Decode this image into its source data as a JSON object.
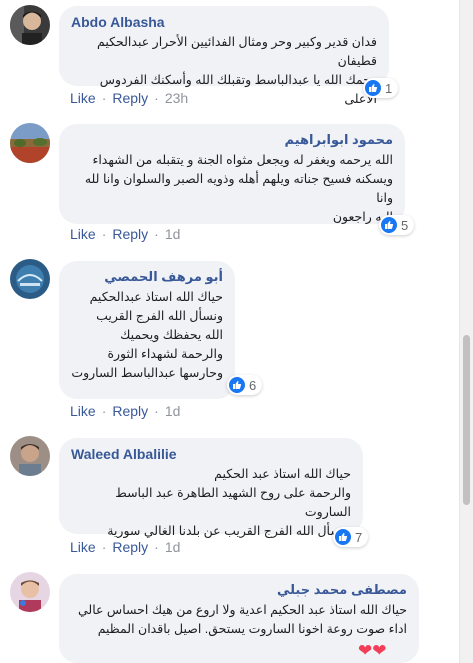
{
  "comments": [
    {
      "author": "Abdo Albasha",
      "text": "فدان قدير وكبير وحر ومثال الفدائيين الأحرار عبدالحكيم قطيفان\nرحمك الله يا عبدالباسط وتقبلك الله وأسكنك الفردوس الأعلى",
      "reactions": "1",
      "like_label": "Like",
      "reply_label": "Reply",
      "time": "23h"
    },
    {
      "author": "محمود ابوابراهيم",
      "text": "الله يرحمه ويغفر له ويجعل مثواه الجنة و يتقبله من الشهداء\nويسكنه فسيح جناته ويلهم أهله وذويه الصبر والسلوان وانا لله وانا\nاليه راجعون",
      "reactions": "5",
      "like_label": "Like",
      "reply_label": "Reply",
      "time": "1d"
    },
    {
      "author": "أبو مرهف الحمصي",
      "text": "حياك الله استاذ عبدالحكيم\nونسأل الله الفرج القريب\nالله يحفظك ويحميك\nوالرحمة لشهداء الثورة\nوحارسها عبدالباسط الساروت",
      "reactions": "6",
      "like_label": "Like",
      "reply_label": "Reply",
      "time": "1d"
    },
    {
      "author": "Waleed Albalilie",
      "text": "حياك الله استاذ عبد الحكيم\nوالرحمة على روح الشهيد الطاهرة عبد الباسط الساروت\nونسأل الله الفرج القريب عن بلدنا الغالي سورية",
      "reactions": "7",
      "like_label": "Like",
      "reply_label": "Reply",
      "time": "1d"
    },
    {
      "author": "مصطفى محمد جبلي",
      "text": "حياك الله استاذ عبد الحكيم اعدية ولا اروع من هيك احساس عالي\nاداء صوت روعة اخونا الساروت يستحق. اصيل باقدان المظيم",
      "emoji": "❤❤"
    }
  ],
  "colors": {
    "link": "#385898",
    "meta": "#90949c",
    "bubble": "#f0f2f5",
    "like_blue": "#1877f2",
    "heart": "#f33e58"
  }
}
